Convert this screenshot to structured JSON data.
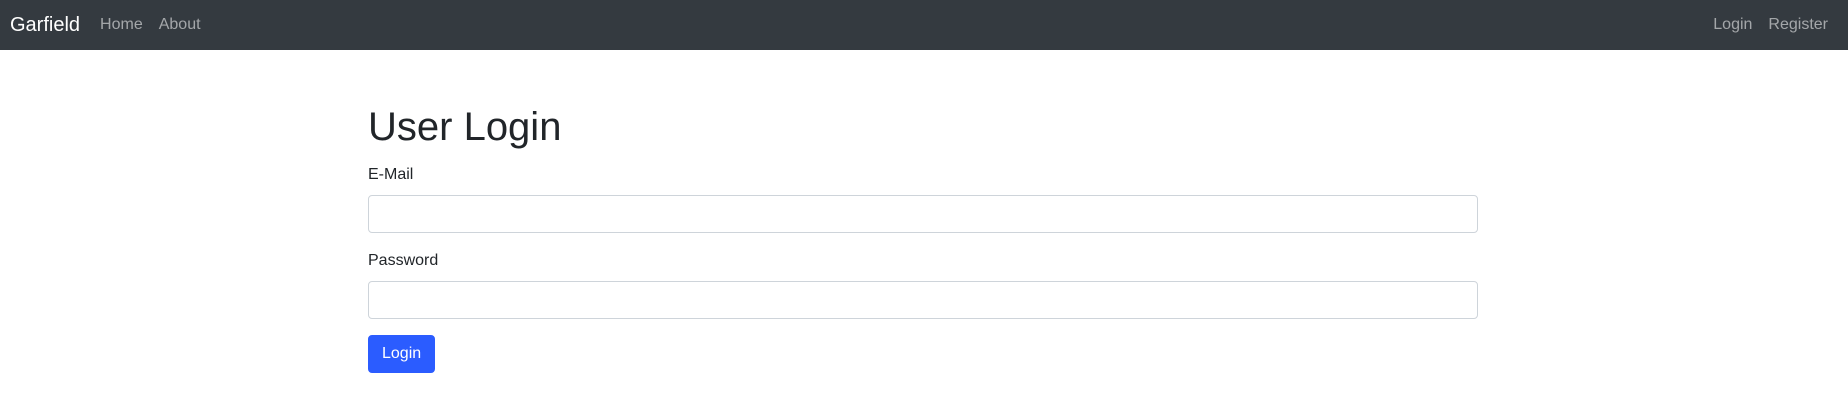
{
  "navbar": {
    "brand": "Garfield",
    "left_links": [
      "Home",
      "About"
    ],
    "right_links": [
      "Login",
      "Register"
    ],
    "background_color": "#343a40"
  },
  "main": {
    "title": "User Login",
    "email": {
      "label": "E-Mail",
      "value": "",
      "placeholder": ""
    },
    "password": {
      "label": "Password",
      "value": "",
      "placeholder": ""
    },
    "submit_label": "Login",
    "accent_color": "#2b5cff"
  }
}
